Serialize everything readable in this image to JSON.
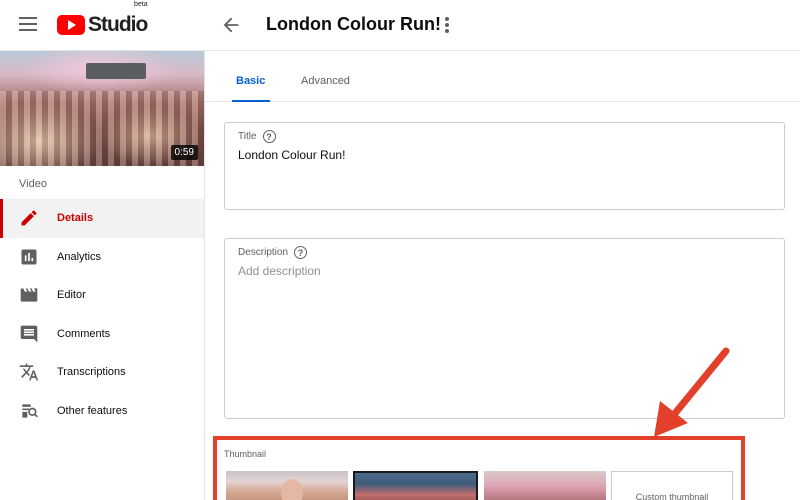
{
  "header": {
    "logo_text": "Studio",
    "logo_badge": "beta",
    "title": "London Colour Run!"
  },
  "sidebar": {
    "video_duration": "0:59",
    "section_label": "Video",
    "items": [
      {
        "label": "Details",
        "icon": "pencil-icon",
        "active": true
      },
      {
        "label": "Analytics",
        "icon": "bar-chart-icon",
        "active": false
      },
      {
        "label": "Editor",
        "icon": "clapperboard-icon",
        "active": false
      },
      {
        "label": "Comments",
        "icon": "comment-icon",
        "active": false
      },
      {
        "label": "Transcriptions",
        "icon": "translate-icon",
        "active": false
      },
      {
        "label": "Other features",
        "icon": "features-icon",
        "active": false
      }
    ]
  },
  "tabs": [
    {
      "label": "Basic",
      "active": true
    },
    {
      "label": "Advanced",
      "active": false
    }
  ],
  "form": {
    "title_label": "Title",
    "title_value": "London Colour Run!",
    "description_label": "Description",
    "description_placeholder": "Add description"
  },
  "thumbnail": {
    "label": "Thumbnail",
    "custom_label": "Custom thumbnail"
  },
  "colors": {
    "accent_blue": "#065fd4",
    "active_red": "#cc0000",
    "annotation_red": "#e3402c"
  }
}
